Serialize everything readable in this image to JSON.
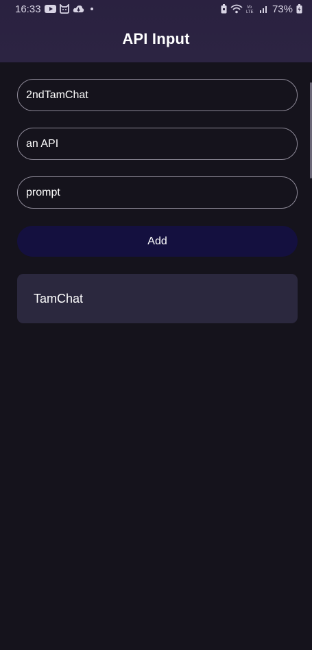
{
  "status_bar": {
    "time": "16:33",
    "battery_percent": "73%",
    "icons_left": [
      "youtube-icon",
      "cat-icon",
      "cloud-icon",
      "dot-icon"
    ],
    "icons_right": [
      "battery-saver-icon",
      "wifi-icon",
      "volte-icon",
      "signal-icon",
      "battery-icon"
    ],
    "volte_label": "Vo))\nLTE"
  },
  "app_bar": {
    "title": "API Input"
  },
  "form": {
    "field_1_value": "2ndTamChat",
    "field_2_value": "an API",
    "field_3_value": "prompt",
    "add_label": "Add"
  },
  "list": {
    "items": [
      {
        "label": "TamChat"
      }
    ]
  },
  "colors": {
    "background": "#15131c",
    "header": "#2a2140",
    "button": "#14103f",
    "card": "#2b283e",
    "field_border": "#8e8a98"
  }
}
